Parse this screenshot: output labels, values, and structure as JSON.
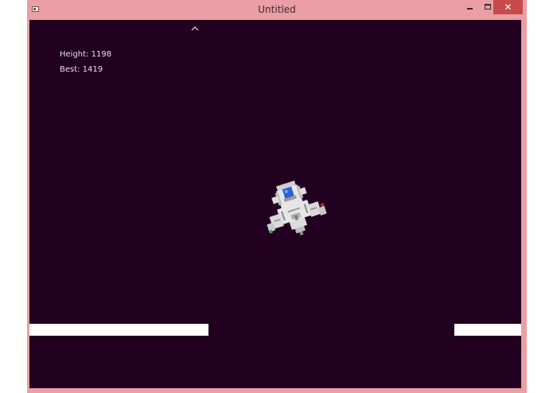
{
  "window": {
    "title": "Untitled",
    "close_glyph": "✕"
  },
  "hud": {
    "height_label": "Height: 1198",
    "best_label": "Best: 1419",
    "height": 1198,
    "best": 1419
  },
  "icons": {
    "app": "app-icon",
    "minimize": "minimize-icon",
    "maximize": "maximize-icon",
    "close": "close-icon",
    "indicator": "caret-up-icon",
    "player": "spaceship-sprite"
  },
  "colors": {
    "frame": "#eb9ea4",
    "background": "#210020",
    "platform": "#ffffff",
    "close_button": "#c74a4a",
    "hud_text": "#e8e0e8",
    "ship_cockpit": "#2f5fd8",
    "ship_body": "#e6e6e6"
  }
}
